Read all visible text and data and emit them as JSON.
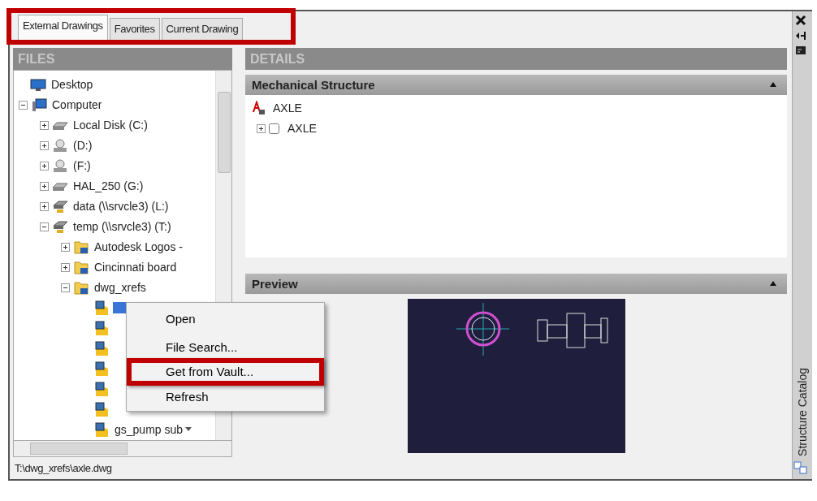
{
  "tabs": [
    {
      "label": "External Drawings",
      "selected": true
    },
    {
      "label": "Favorites",
      "selected": false
    },
    {
      "label": "Current Drawing",
      "selected": false
    }
  ],
  "tabs_highlighted": true,
  "side_tab": "Structure Catalog",
  "files": {
    "header": "FILES",
    "path": "T:\\dwg_xrefs\\axle.dwg",
    "tree": [
      {
        "label": "Desktop",
        "kind": "desktop"
      },
      {
        "label": "Computer",
        "kind": "computer",
        "expanded": true,
        "children": [
          {
            "label": "Local Disk (C:)",
            "kind": "drive",
            "expanded": false
          },
          {
            "label": "(D:)",
            "kind": "cd",
            "expanded": false
          },
          {
            "label": "(F:)",
            "kind": "cd",
            "expanded": false
          },
          {
            "label": "HAL_250 (G:)",
            "kind": "drive",
            "expanded": false
          },
          {
            "label": "data (\\\\srvcle3) (L:)",
            "kind": "network",
            "expanded": false
          },
          {
            "label": "temp (\\\\srvcle3) (T:)",
            "kind": "network",
            "expanded": true,
            "children": [
              {
                "label": "Autodesk Logos -",
                "kind": "folder",
                "expanded": false
              },
              {
                "label": "Cincinnati board",
                "kind": "folder",
                "expanded": false
              },
              {
                "label": "dwg_xrefs",
                "kind": "folder",
                "expanded": true,
                "children": [
                  {
                    "kind": "file",
                    "selected": true
                  },
                  {
                    "kind": "file",
                    "selected": false
                  },
                  {
                    "kind": "file",
                    "selected": false
                  },
                  {
                    "kind": "file",
                    "selected": false
                  },
                  {
                    "kind": "file",
                    "selected": false
                  },
                  {
                    "kind": "file",
                    "selected": false
                  },
                  {
                    "label": "gs_pump sub",
                    "kind": "file",
                    "selected": false
                  }
                ]
              }
            ]
          }
        ]
      }
    ]
  },
  "details": {
    "header": "DETAILS",
    "structure": {
      "title": "Mechanical Structure",
      "expanded": true,
      "tree": [
        {
          "label": "AXLE",
          "kind": "model",
          "children": [
            {
              "label": "AXLE",
              "kind": "part",
              "expanded": false,
              "checked": false
            }
          ]
        }
      ]
    },
    "preview": {
      "title": "Preview",
      "expanded": true
    }
  },
  "context_menu": {
    "items": [
      {
        "label": "Open",
        "highlighted": false
      },
      {
        "label": "File Search...",
        "highlighted": false
      },
      {
        "label": "Get from Vault...",
        "highlighted": true
      },
      {
        "label": "Refresh",
        "highlighted": false
      }
    ]
  }
}
